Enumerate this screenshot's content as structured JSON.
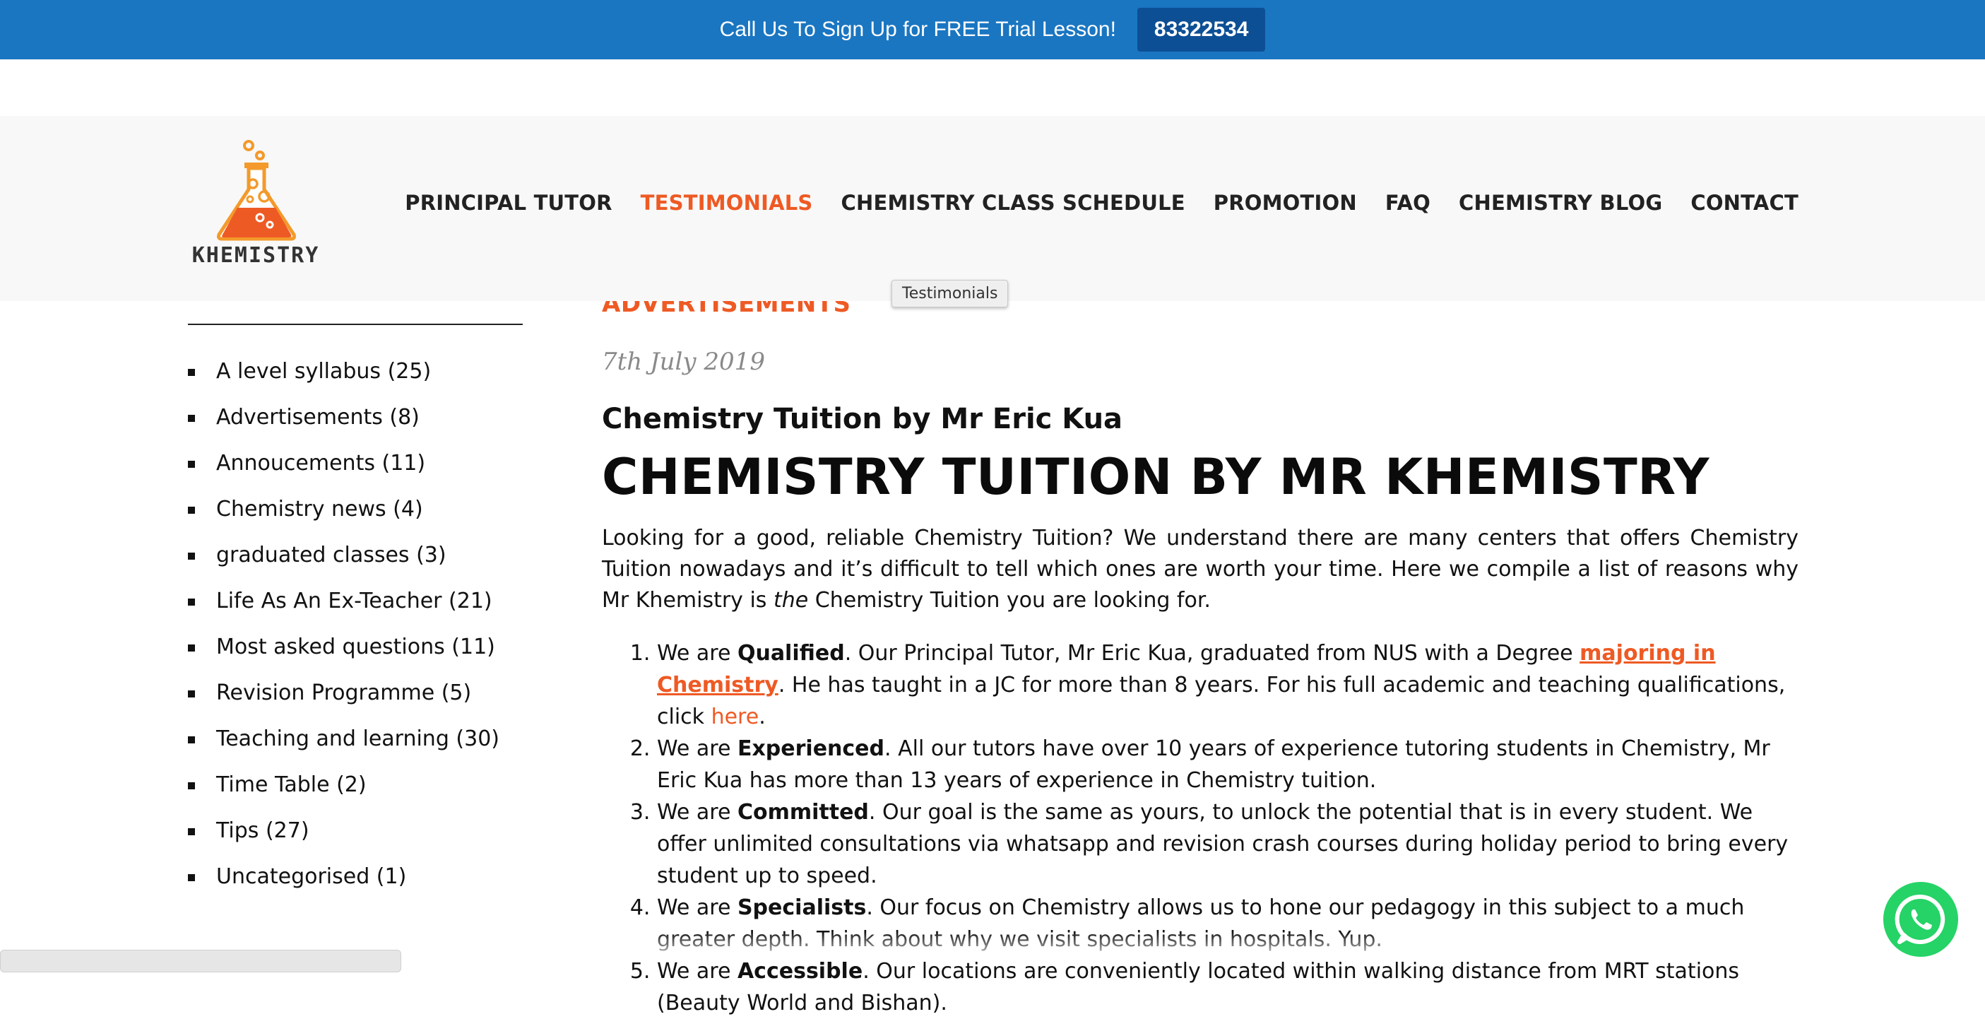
{
  "topbar": {
    "message": "Call Us To Sign Up for FREE Trial Lesson!",
    "phone": "83322534"
  },
  "brand": {
    "logo_text": "KHEMISTRY",
    "accent": "#ee5a24",
    "bar_color": "#1a76c1"
  },
  "nav": {
    "items": [
      {
        "label": "PRINCIPAL TUTOR"
      },
      {
        "label": "TESTIMONIALS",
        "active": true
      },
      {
        "label": "CHEMISTRY CLASS SCHEDULE"
      },
      {
        "label": "PROMOTION"
      },
      {
        "label": "FAQ"
      },
      {
        "label": "CHEMISTRY BLOG"
      },
      {
        "label": "CONTACT"
      }
    ],
    "tooltip": "Testimonials"
  },
  "sidebar": {
    "categories": [
      "A level syllabus (25)",
      "Advertisements (8)",
      "Annoucements (11)",
      "Chemistry news (4)",
      "graduated classes (3)",
      "Life As An Ex-Teacher (21)",
      "Most asked questions (11)",
      "Revision Programme (5)",
      "Teaching and learning (30)",
      "Time Table (2)",
      "Tips (27)",
      "Uncategorised (1)"
    ]
  },
  "post": {
    "category": "ADVERTISEMENTS",
    "date": "7th July 2019",
    "title": "Chemistry Tuition by Mr Eric Kua",
    "headline": "CHEMISTRY TUITION BY MR KHEMISTRY",
    "intro_part1": "Looking for a good, reliable Chemistry Tuition? We understand there are many centers that offers Chemistry Tuition nowadays and it’s difficult to tell which ones are worth your time. Here we compile a list of reasons why Mr Khemistry is ",
    "intro_em": "the",
    "intro_part2": " Chemistry Tuition you are looking for.",
    "reasons": [
      {
        "pre": "We are ",
        "strong": "Qualified",
        "text": ". Our Principal Tutor, Mr Eric Kua, graduated from NUS with a Degree ",
        "link1": "majoring in Chemistry",
        "text2": ". He has taught in a JC for more than 8 years. For his full academic and teaching qualifications, click ",
        "link2": "here",
        "text3": "."
      },
      {
        "pre": "We are ",
        "strong": "Experienced",
        "text": ". All our tutors have over 10 years of experience tutoring students in Chemistry, Mr Eric Kua has more than 13 years of experience in Chemistry tuition."
      },
      {
        "pre": "We are ",
        "strong": "Committed",
        "text": ". Our goal is the same as yours, to unlock the potential that is in every student. We offer unlimited consultations via whatsapp and revision crash courses during holiday period to bring every student up to speed."
      },
      {
        "pre": "We are ",
        "strong": "Specialists",
        "text": ". Our focus on Chemistry allows us to hone our pedagogy in this subject to a much greater depth. Think about why we visit specialists in hospitals. Yup."
      },
      {
        "pre": " We are ",
        "strong": "Accessible",
        "text": ". Our locations are conveniently located within walking distance from MRT stations (Beauty World and Bishan)."
      }
    ]
  }
}
